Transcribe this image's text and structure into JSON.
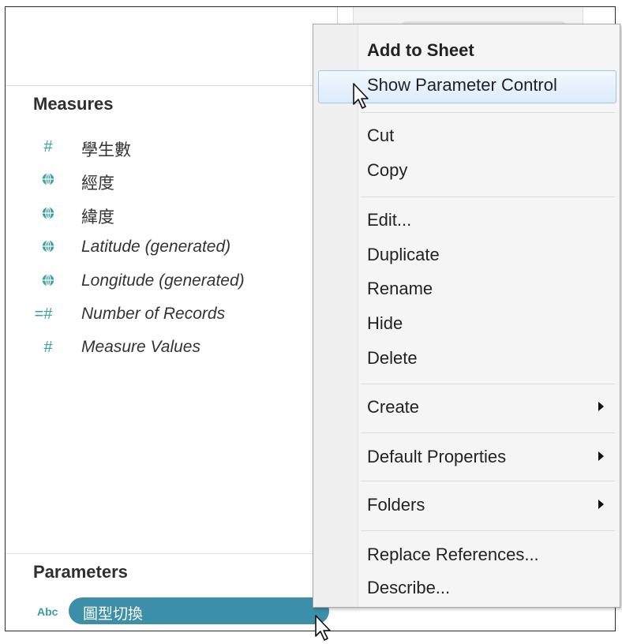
{
  "data_pane": {
    "measures_title": "Measures",
    "measures": [
      {
        "icon": "number-icon",
        "glyph": "#",
        "name": "學生數",
        "italic": false
      },
      {
        "icon": "globe-icon",
        "glyph": "",
        "name": "經度",
        "italic": false
      },
      {
        "icon": "globe-icon",
        "glyph": "",
        "name": "緯度",
        "italic": false
      },
      {
        "icon": "globe-icon",
        "glyph": "",
        "name": "Latitude (generated)",
        "italic": true
      },
      {
        "icon": "globe-icon",
        "glyph": "",
        "name": "Longitude (generated)",
        "italic": true
      },
      {
        "icon": "calc-number-icon",
        "glyph": "=#",
        "name": "Number of Records",
        "italic": true
      },
      {
        "icon": "number-icon",
        "glyph": "#",
        "name": "Measure Values",
        "italic": true
      }
    ],
    "parameters_title": "Parameters",
    "parameter": {
      "type_label": "Abc",
      "name": "圖型切換"
    }
  },
  "context_menu": {
    "items": [
      {
        "label": "Add to Sheet",
        "bold": true
      },
      {
        "label": "Show Parameter Control",
        "highlighted": true
      },
      {
        "label": "Cut"
      },
      {
        "label": "Copy"
      },
      {
        "label": "Edit..."
      },
      {
        "label": "Duplicate"
      },
      {
        "label": "Rename"
      },
      {
        "label": "Hide"
      },
      {
        "label": "Delete"
      },
      {
        "label": "Create",
        "submenu": true
      },
      {
        "label": "Default Properties",
        "submenu": true
      },
      {
        "label": "Folders",
        "submenu": true
      },
      {
        "label": "Replace References..."
      },
      {
        "label": "Describe..."
      }
    ]
  },
  "colors": {
    "accent_teal": "#3aa19a",
    "pill_blue": "#3b8fa8",
    "highlight_border": "#9ec5ee"
  }
}
